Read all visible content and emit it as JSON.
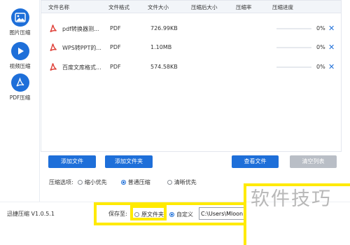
{
  "sidebar": {
    "items": [
      {
        "label": "图片压缩",
        "icon": "image-icon"
      },
      {
        "label": "视频压缩",
        "icon": "play-icon"
      },
      {
        "label": "PDF压缩",
        "icon": "pdf-icon"
      }
    ]
  },
  "table": {
    "headers": [
      "文件名称",
      "文件格式",
      "文件大小",
      "压缩后大小",
      "压缩率",
      "压缩进度"
    ],
    "rows": [
      {
        "name": "pdf转换器测...",
        "format": "PDF",
        "size": "726.99KB",
        "after": "",
        "ratio": "",
        "progress": 0,
        "progress_text": "0%"
      },
      {
        "name": "WPS转PPT的...",
        "format": "PDF",
        "size": "1.10MB",
        "after": "",
        "ratio": "",
        "progress": 0,
        "progress_text": "0%"
      },
      {
        "name": "百度文库格式...",
        "format": "PDF",
        "size": "574.58KB",
        "after": "",
        "ratio": "",
        "progress": 0,
        "progress_text": "0%"
      }
    ],
    "remove_symbol": "✕"
  },
  "buttons": {
    "add_file": "添加文件",
    "add_folder": "添加文件夹",
    "view_file": "查看文件",
    "clear_list": "清空列表"
  },
  "compress_options": {
    "label": "压缩选项:",
    "options": [
      "缩小优先",
      "普通压缩",
      "清晰优先"
    ],
    "selected": "普通压缩"
  },
  "footer": {
    "version": "迅捷压缩 V1.0.5.1",
    "save_to": "保存至:",
    "original_folder": "原文件夹",
    "custom": "自定义",
    "path_value": "C:\\Users\\Mloong",
    "selected": "自定义"
  },
  "watermark": "软件技巧",
  "colors": {
    "accent": "#1e6fd9",
    "pdf_red": "#e0443c",
    "highlight": "#ffea00",
    "disabled_button": "#b9bec6"
  }
}
